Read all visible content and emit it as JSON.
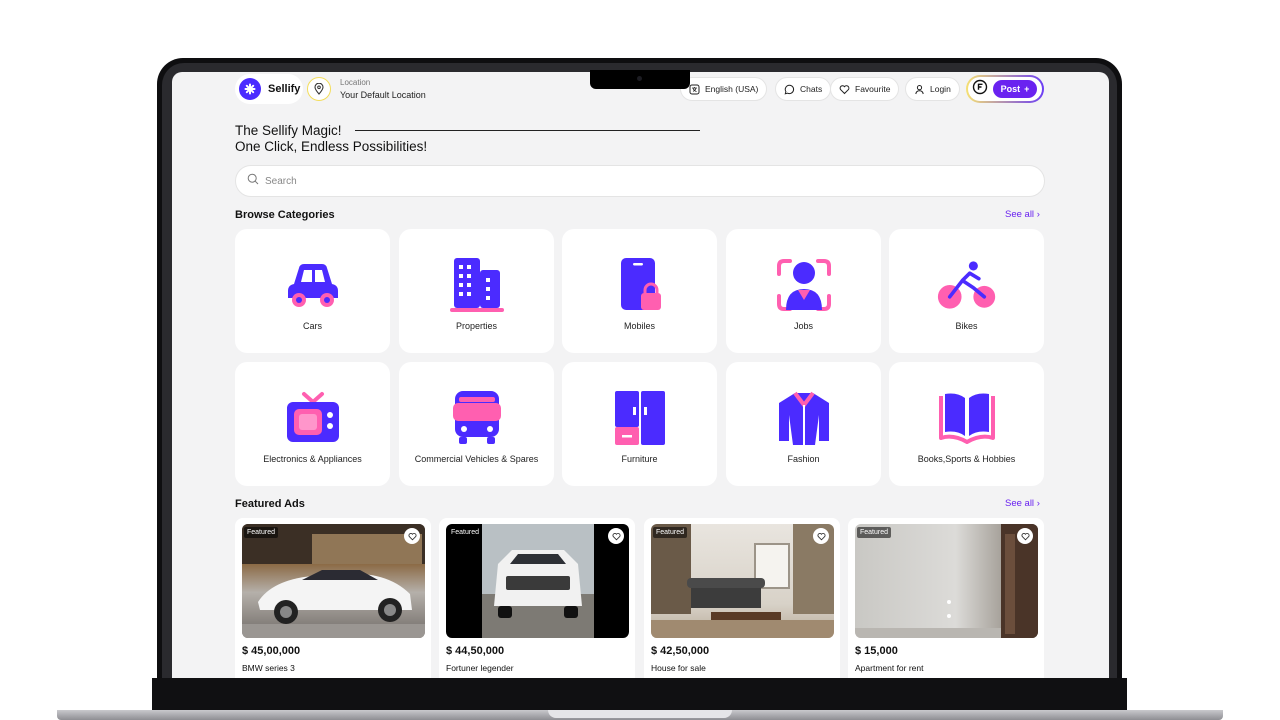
{
  "brand": {
    "name": "Sellify"
  },
  "location": {
    "label": "Location",
    "value": "Your Default Location"
  },
  "nav": {
    "language": "English (USA)",
    "chats": "Chats",
    "favourite": "Favourite",
    "login": "Login",
    "post": "Post"
  },
  "hero": {
    "line1": "The Sellify Magic!",
    "line2": "One Click, Endless Possibilities!"
  },
  "search": {
    "placeholder": "Search"
  },
  "categories": {
    "title": "Browse Categories",
    "see_all": "See all",
    "items": [
      {
        "label": "Cars",
        "icon": "car-icon"
      },
      {
        "label": "Properties",
        "icon": "building-icon"
      },
      {
        "label": "Mobiles",
        "icon": "mobile-lock-icon"
      },
      {
        "label": "Jobs",
        "icon": "person-icon"
      },
      {
        "label": "Bikes",
        "icon": "bicycle-icon"
      },
      {
        "label": "Electronics & Appliances",
        "icon": "tv-icon"
      },
      {
        "label": "Commercial Vehicles & Spares",
        "icon": "bus-icon"
      },
      {
        "label": "Furniture",
        "icon": "cabinet-icon"
      },
      {
        "label": "Fashion",
        "icon": "jacket-icon"
      },
      {
        "label": "Books,Sports & Hobbies",
        "icon": "book-icon"
      }
    ]
  },
  "featured": {
    "title": "Featured Ads",
    "see_all": "See all",
    "items": [
      {
        "badge": "Featured",
        "price": "$ 45,00,000",
        "title": "BMW series 3"
      },
      {
        "badge": "Featured",
        "price": "$ 44,50,000",
        "title": "Fortuner legender"
      },
      {
        "badge": "Featured",
        "price": "$ 42,50,000",
        "title": "House for sale"
      },
      {
        "badge": "Featured",
        "price": "$ 15,000",
        "title": "Apartment for rent"
      }
    ]
  },
  "colors": {
    "primary": "#4b2bff",
    "accent": "#ff5fb0",
    "post": "#6a22f0"
  }
}
